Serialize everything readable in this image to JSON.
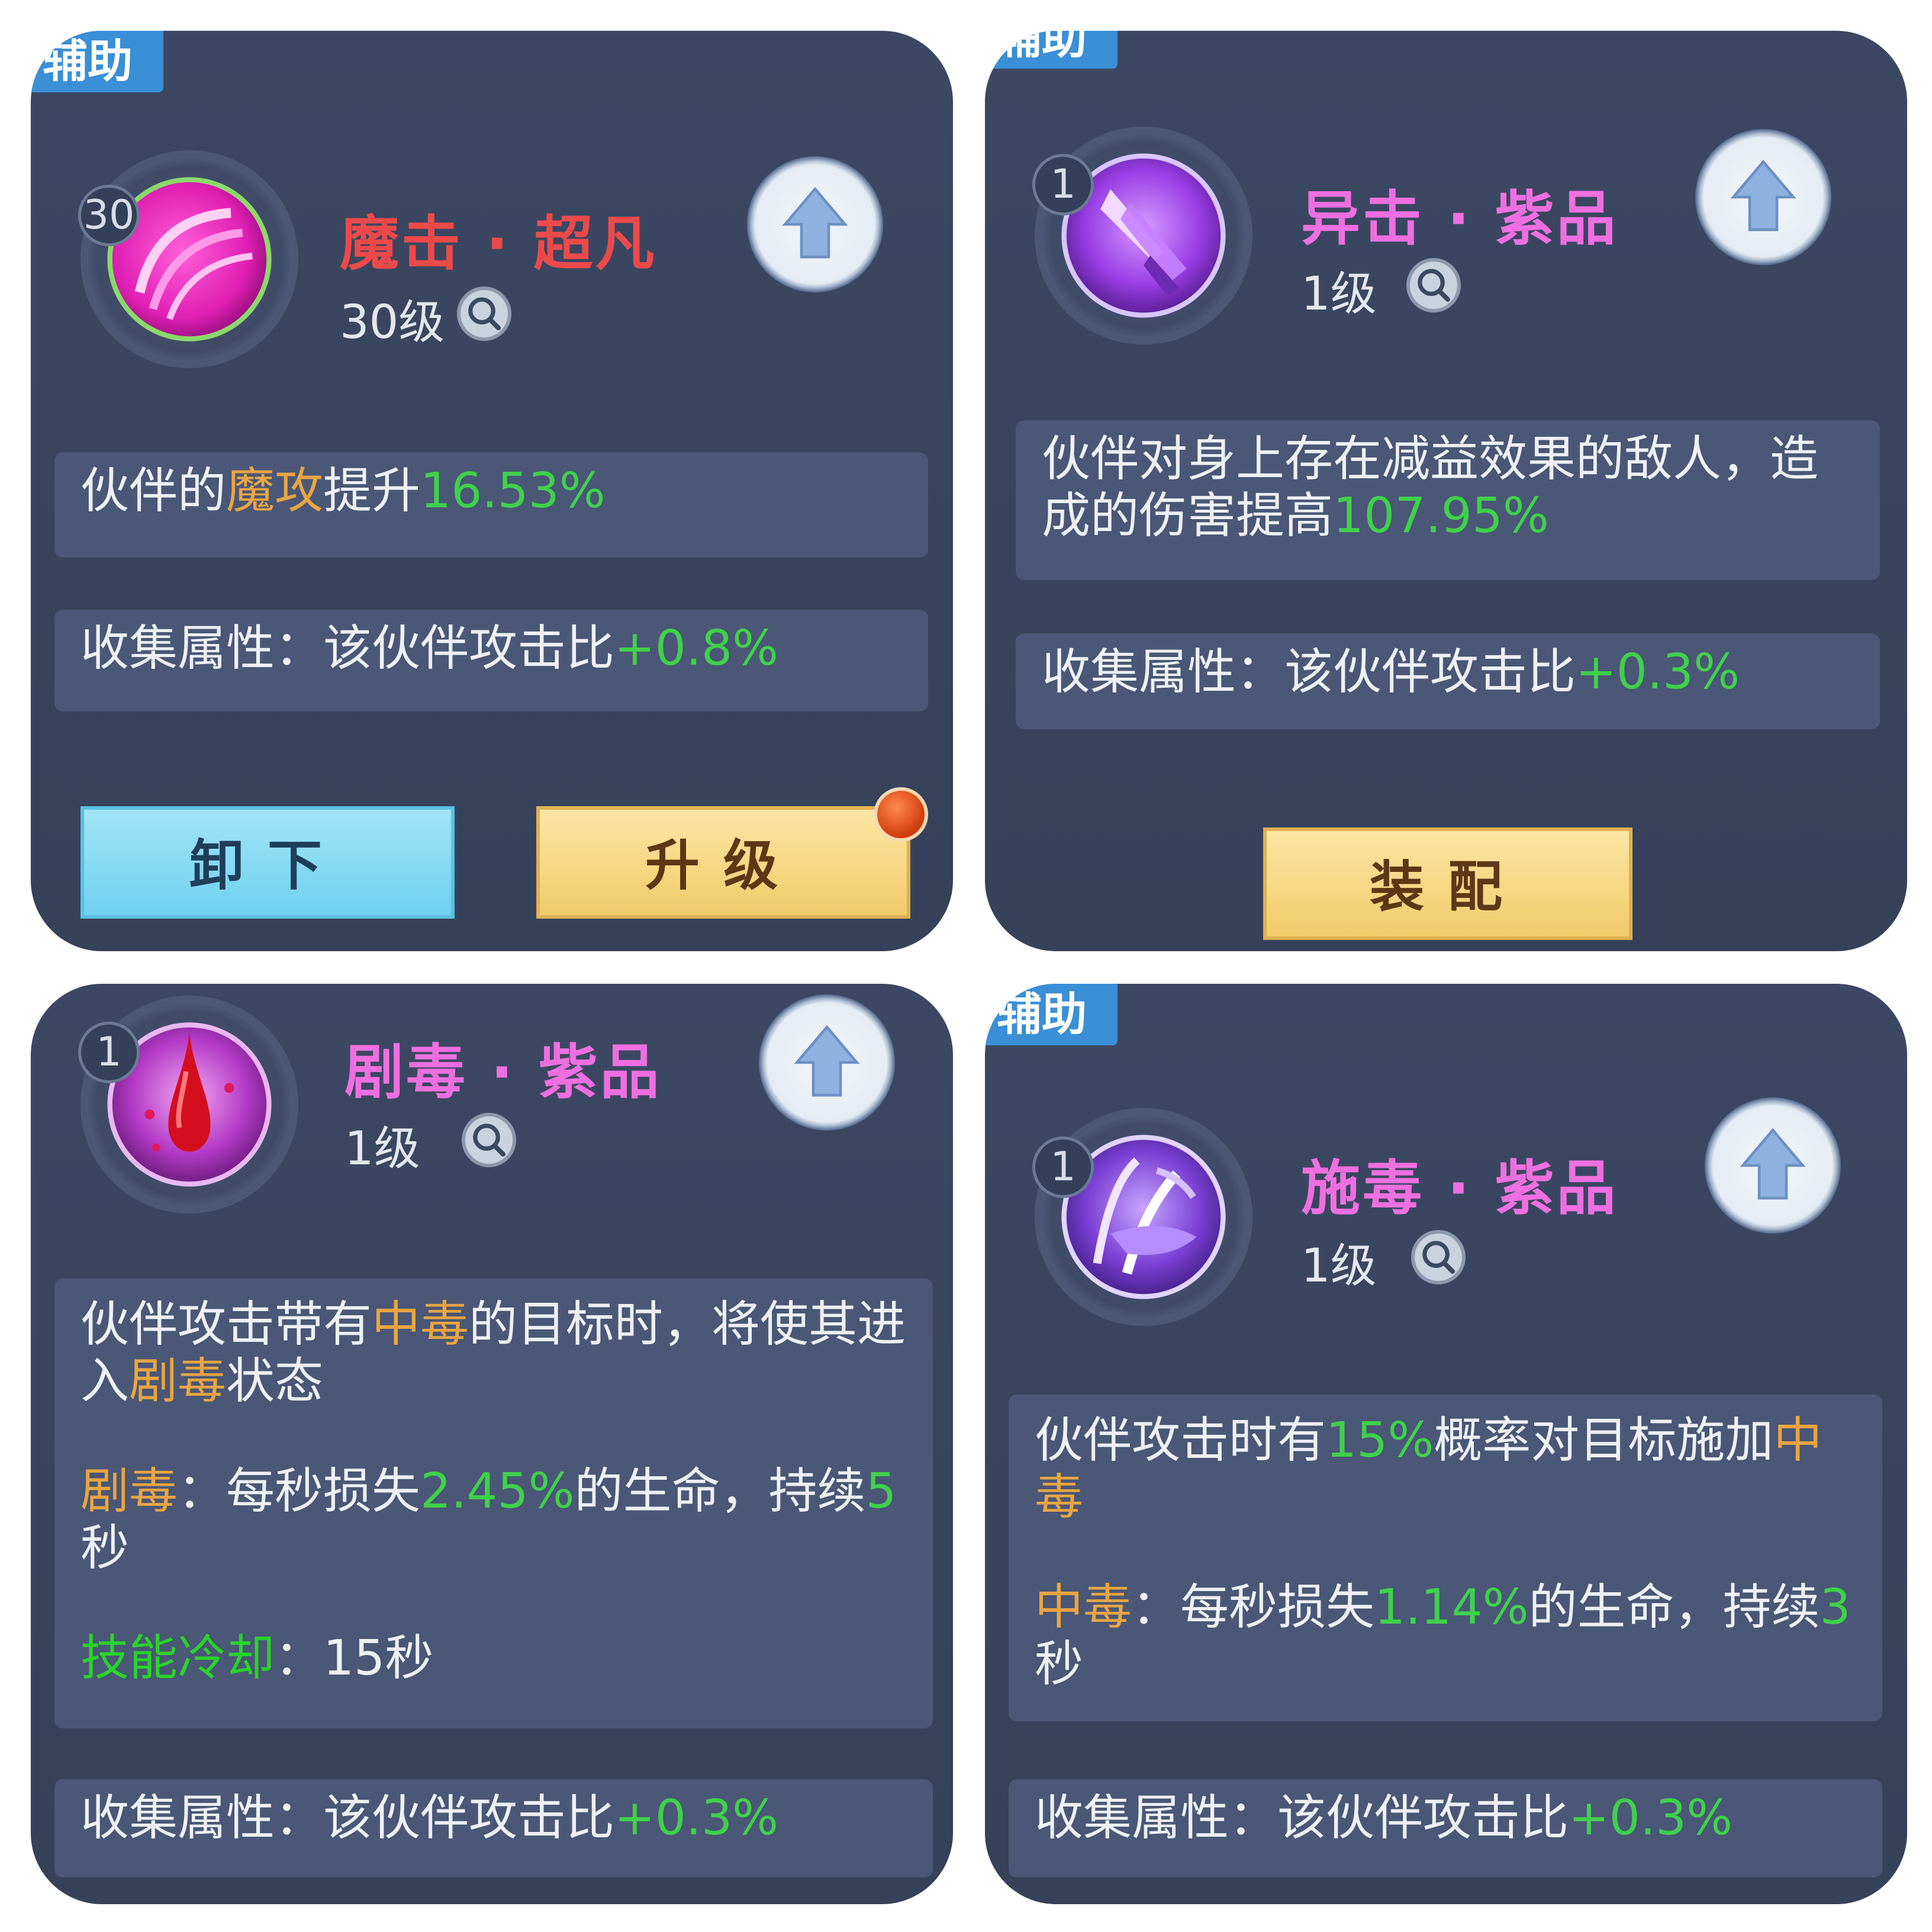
{
  "cards": [
    {
      "tag": "辅助",
      "level_badge": "30",
      "name": "魔击 · 超凡",
      "name_color": "#ec4a4a",
      "level": "30级",
      "icon": "magic-strike-icon",
      "desc": {
        "a": "伙伴的",
        "b": "魔攻",
        "c": "提升",
        "d": "16.53%"
      },
      "collect": {
        "label": "收集属性：该伙伴攻击比",
        "value": "+0.8%"
      },
      "buttons": {
        "unequip": "卸下",
        "upgrade": "升级"
      }
    },
    {
      "tag": "辅助",
      "level_badge": "1",
      "name": "异击 · 紫品",
      "name_color": "#ef6fe0",
      "level": "1级",
      "icon": "odd-strike-icon",
      "desc": {
        "a": "伙伴对身上存在减益效果的敌人，造成的伤害提高",
        "b": "107.95%"
      },
      "collect": {
        "label": "收集属性：该伙伴攻击比",
        "value": "+0.3%"
      },
      "buttons": {
        "equip": "装配"
      }
    },
    {
      "level_badge": "1",
      "name": "剧毒 · 紫品",
      "name_color": "#ef6fe0",
      "level": "1级",
      "icon": "poison-drop-icon",
      "desc": {
        "a": "伙伴攻击带有",
        "b": "中毒",
        "c": "的目标时，将使其进入",
        "d": "剧毒",
        "e": "状态",
        "f": "剧毒",
        "g": "：每秒损失",
        "h": "2.45%",
        "i": "的生命，持续",
        "j": "5",
        "k": "秒",
        "l": "技能冷却",
        "m": "：15秒"
      },
      "collect": {
        "label": "收集属性：该伙伴攻击比",
        "value": "+0.3%"
      }
    },
    {
      "tag": "辅助",
      "level_badge": "1",
      "name": "施毒 · 紫品",
      "name_color": "#ef6fe0",
      "level": "1级",
      "icon": "apply-poison-icon",
      "desc": {
        "a": "伙伴攻击时有",
        "b": "15%",
        "c": "概率对目标施加",
        "d": "中毒",
        "e": "中毒",
        "f": "：每秒损失",
        "g": "1.14%",
        "h": "的生命，持续",
        "i": "3",
        "j": "秒"
      },
      "collect": {
        "label": "收集属性：该伙伴攻击比",
        "value": "+0.3%"
      }
    }
  ]
}
